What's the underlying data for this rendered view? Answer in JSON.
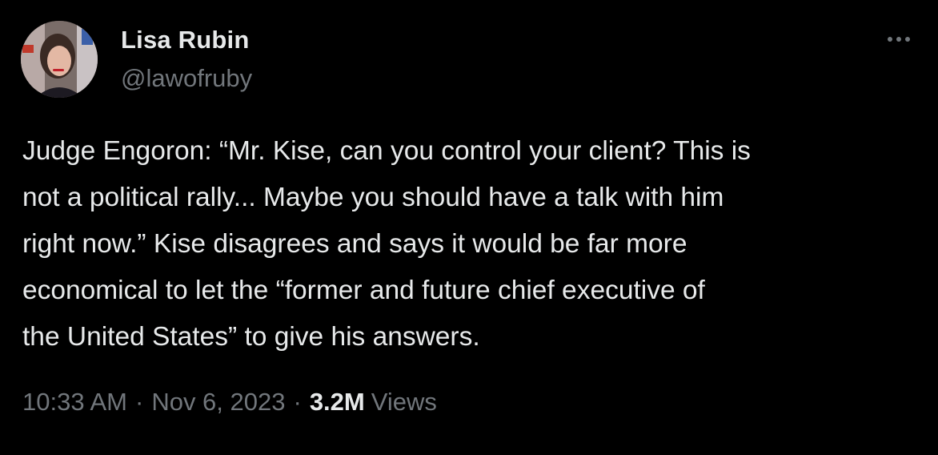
{
  "author": {
    "name": "Lisa Rubin",
    "handle": "@lawofruby"
  },
  "tweet": {
    "text": "Judge Engoron: “Mr. Kise, can you control your client? This is\nnot a political rally... Maybe you should have a talk with him\nright now.” Kise disagrees and says it would be far more\neconomical to let the “former and future chief executive of\nthe United States” to give his answers."
  },
  "meta": {
    "time": "10:33 AM",
    "separator": "·",
    "date": "Nov 6, 2023",
    "views_count": "3.2M",
    "views_label": "Views"
  },
  "colors": {
    "background": "#000000",
    "primary_text": "#e7e9ea",
    "secondary_text": "#71767b"
  },
  "icons": {
    "more": "more-horizontal-icon"
  }
}
